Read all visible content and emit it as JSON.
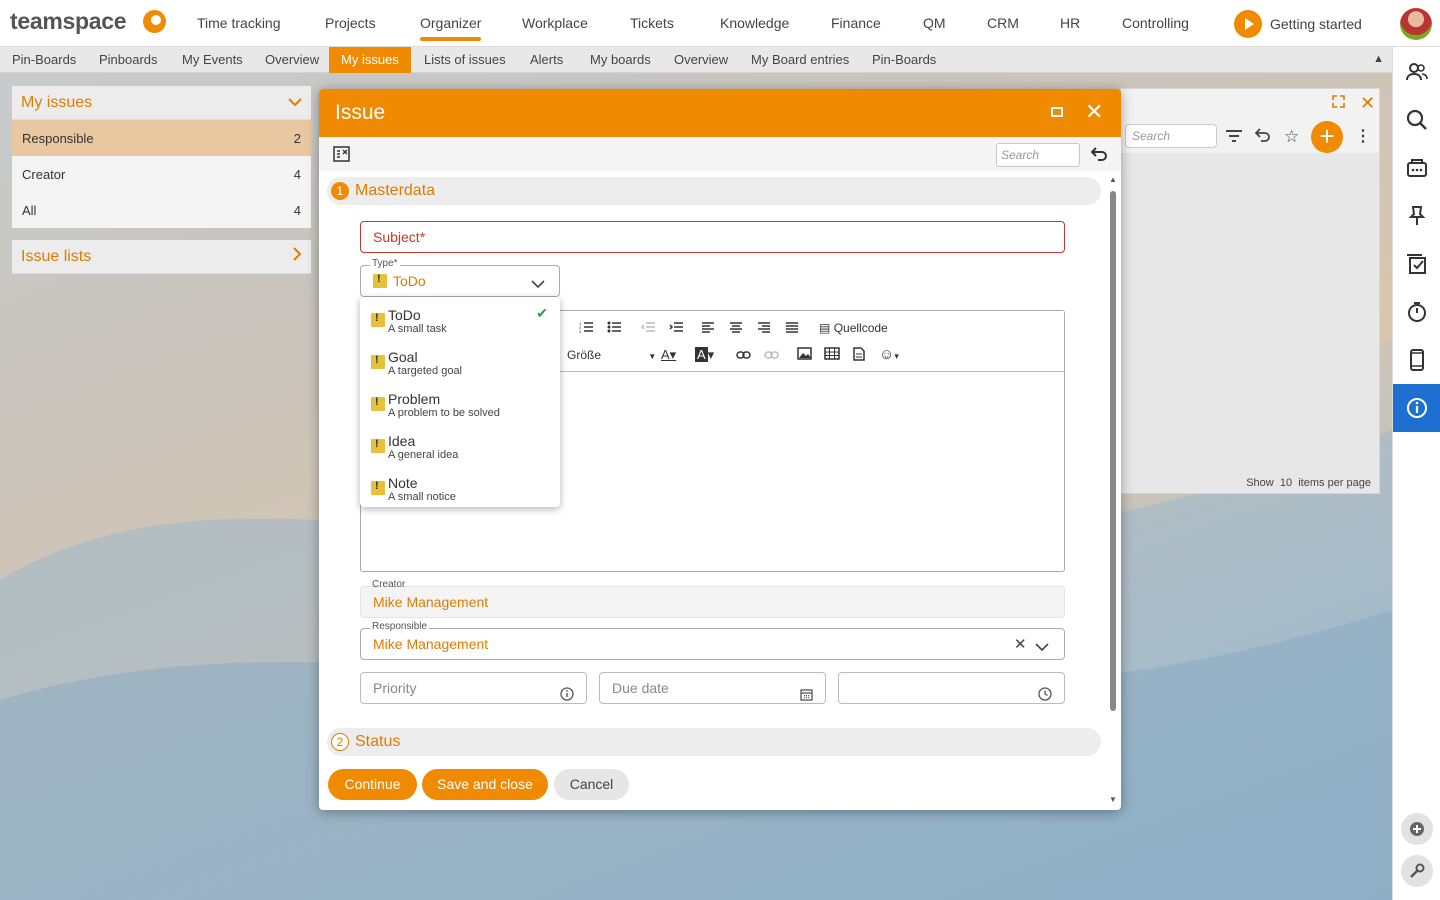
{
  "app": {
    "logo": "teamspace"
  },
  "main_nav": [
    "Time tracking",
    "Projects",
    "Organizer",
    "Workplace",
    "Tickets",
    "Knowledge",
    "Finance",
    "QM",
    "CRM",
    "HR",
    "Controlling"
  ],
  "main_nav_active": "Organizer",
  "getting_started": "Getting started",
  "sub_nav": [
    "Pin-Boards",
    "Pinboards",
    "My Events",
    "Overview",
    "My issues",
    "Lists of issues",
    "Alerts",
    "My boards",
    "Overview",
    "My Board entries",
    "Pin-Boards"
  ],
  "sub_nav_active": "My issues",
  "left_panel": {
    "my_issues_title": "My issues",
    "rows": [
      {
        "label": "Responsible",
        "count": "2"
      },
      {
        "label": "Creator",
        "count": "4"
      },
      {
        "label": "All",
        "count": "4"
      }
    ],
    "issue_lists_title": "Issue lists"
  },
  "background_window": {
    "search_placeholder": "Search",
    "show_label": "Show",
    "per_page": "10",
    "items_label": "items per page"
  },
  "dialog": {
    "title": "Issue",
    "search_placeholder": "Search",
    "section1": {
      "number": "1",
      "title": "Masterdata"
    },
    "subject_placeholder": "Subject*",
    "type_label": "Type*",
    "type_value": "ToDo",
    "editor": {
      "source_label": "Quellcode",
      "size_label": "Größe"
    },
    "creator_label": "Creator",
    "creator_value": "Mike Management",
    "responsible_label": "Responsible",
    "responsible_value": "Mike Management",
    "priority_placeholder": "Priority",
    "due_date_placeholder": "Due date",
    "section2": {
      "number": "2",
      "title": "Status"
    },
    "buttons": {
      "continue": "Continue",
      "save_close": "Save and close",
      "cancel": "Cancel"
    }
  },
  "type_dropdown": [
    {
      "title": "ToDo",
      "desc": "A small task",
      "selected": true
    },
    {
      "title": "Goal",
      "desc": "A targeted goal"
    },
    {
      "title": "Problem",
      "desc": "A problem to be solved"
    },
    {
      "title": "Idea",
      "desc": "A general idea"
    },
    {
      "title": "Note",
      "desc": "A small notice"
    }
  ],
  "colors": {
    "accent": "#f08a00",
    "info_blue": "#1d6fd1",
    "check_green": "#2e9a4b"
  }
}
